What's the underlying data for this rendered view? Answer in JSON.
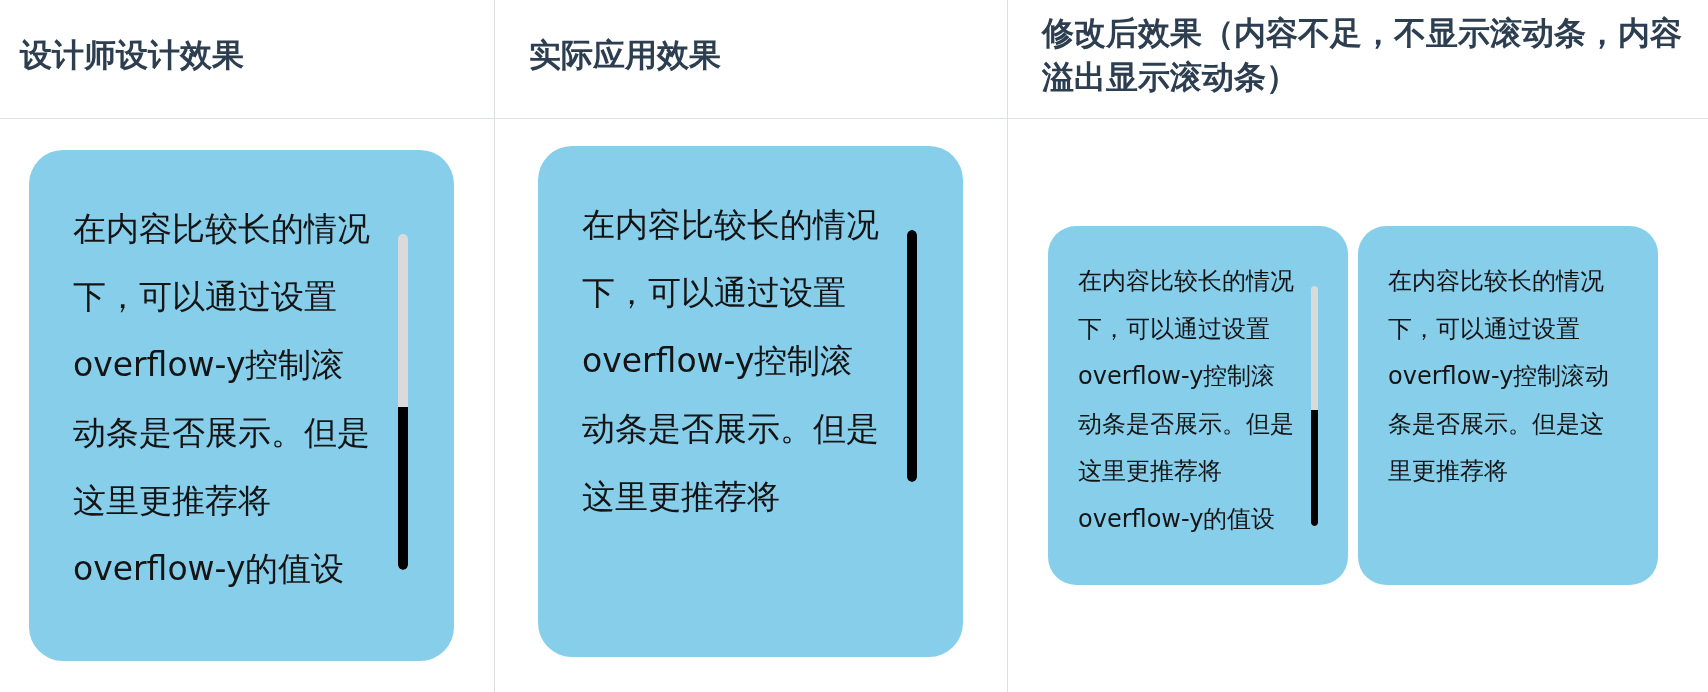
{
  "table": {
    "columns": [
      "设计师设计效果",
      "实际应用效果",
      "修改后效果（内容不足，不显示滚动条，内容溢出显示滚动条）"
    ],
    "rows": [
      {
        "cells": [
          {
            "cards": [
              {
                "text": "在内容比较长的情况下，可以通过设置overflow-y控制滚动条是否展示。但是这里更推荐将overflow-y的值设",
                "scrollbar": true,
                "scrollbar_track": true
              }
            ]
          },
          {
            "cards": [
              {
                "text": "在内容比较长的情况下，可以通过设置overflow-y控制滚动条是否展示。但是这里更推荐将",
                "scrollbar": true,
                "scrollbar_track": false
              }
            ]
          },
          {
            "cards": [
              {
                "text": "在内容比较长的情况下，可以通过设置overflow-y控制滚动条是否展示。但是这里更推荐将overflow-y的值设",
                "scrollbar": true,
                "scrollbar_track": true
              },
              {
                "text": "在内容比较长的情况下，可以通过设置overflow-y控制滚动条是否展示。但是这里更推荐将",
                "scrollbar": false
              }
            ]
          }
        ]
      }
    ]
  }
}
